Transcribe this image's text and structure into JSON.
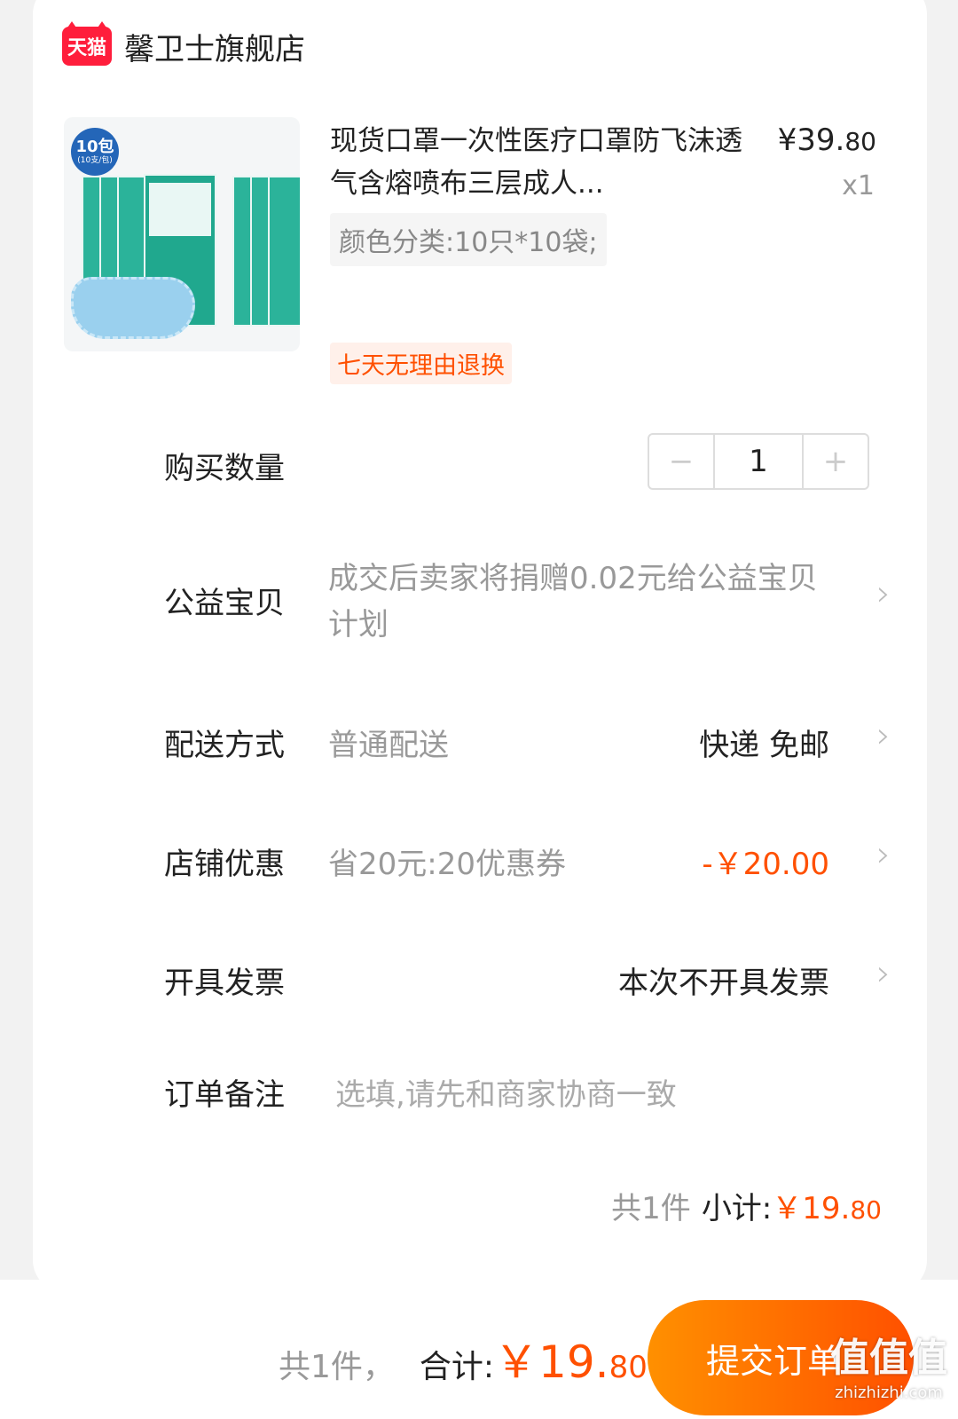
{
  "shop": {
    "badge": "天猫",
    "name": "馨卫士旗舰店"
  },
  "product": {
    "image_badge_main": "10包",
    "image_badge_sub": "(10支/包)",
    "title": "现货口罩一次性医疗口罩防飞沫透气含熔喷布三层成人...",
    "price_main": "¥39.",
    "price_cents": "80",
    "quantity_text": "x1",
    "sku": "颜色分类:10只*10袋;",
    "return_policy": "七天无理由退换"
  },
  "quantity": {
    "label": "购买数量",
    "value": "1",
    "minus": "−",
    "plus": "+"
  },
  "charity": {
    "label": "公益宝贝",
    "desc": "成交后卖家将捐赠0.02元给公益宝贝计划"
  },
  "shipping": {
    "label": "配送方式",
    "desc": "普通配送",
    "value": "快递 免邮"
  },
  "discount": {
    "label": "店铺优惠",
    "desc": "省20元:20优惠券",
    "value": "-￥20.00"
  },
  "invoice": {
    "label": "开具发票",
    "value": "本次不开具发票"
  },
  "note": {
    "label": "订单备注",
    "placeholder": "选填,请先和商家协商一致"
  },
  "subtotal": {
    "count": "共1件",
    "label": "小计:",
    "amount_main": "￥19.",
    "amount_cents": "80"
  },
  "footer": {
    "count": "共1件，",
    "label": "合计:",
    "amount_main": "￥19.",
    "amount_cents": "80",
    "submit": "提交订单"
  },
  "watermark": {
    "logo": "值值值",
    "url": "zhizhizhi.com"
  },
  "colors": {
    "accent": "#ff5000",
    "tmall_red": "#ff1e3c"
  }
}
